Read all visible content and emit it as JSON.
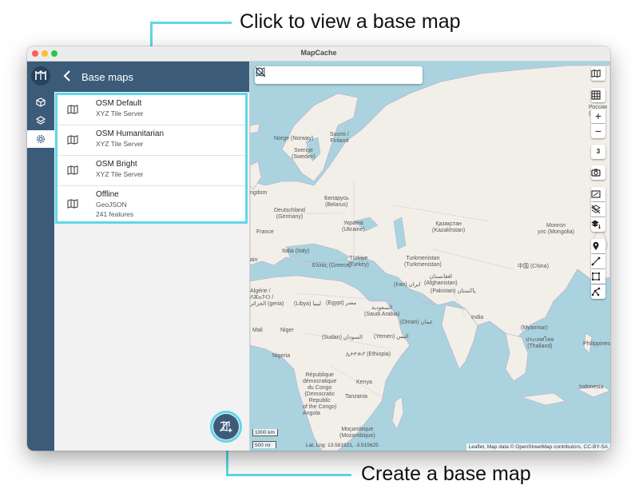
{
  "callouts": {
    "top": "Click to view a base map",
    "bottom": "Create a base map"
  },
  "window": {
    "title": "MapCache"
  },
  "panel": {
    "title": "Base maps",
    "items": [
      {
        "name": "OSM Default",
        "type": "XYZ Tile Server"
      },
      {
        "name": "OSM Humanitarian",
        "type": "XYZ Tile Server"
      },
      {
        "name": "OSM Bright",
        "type": "XYZ Tile Server"
      },
      {
        "name": "Offline",
        "type": "GeoJSON",
        "extra": "241 features"
      }
    ]
  },
  "map": {
    "zoom": "3",
    "zoom_in": "+",
    "zoom_out": "−",
    "scale_km": "1000 km",
    "scale_mi": "500 mi",
    "coords": "Lat, Lng: 13.581921, -3.515625",
    "attribution": "Leaflet, Map data © OpenStreetMap contributors, CC-BY-SA",
    "labels": {
      "norway": "Norge (Norway)",
      "sweden": "Sverige\n(Sweden)",
      "finland": "Suomi /\nFinland",
      "kingdom": "ngdom",
      "germany": "Deutschland\n(Germany)",
      "belarus": "Беларусь\n(Belarus)",
      "ukraine": "Україна\n(Ukraine)",
      "france": "France",
      "italy": "Italia (Italy)",
      "spain": "ain",
      "greece": "Ελλάς (Greece)",
      "turkey": "Türkiye\n(Turkey)",
      "kazakhstan": "Қазақстан\n(Kazakhstan)",
      "mongolia": "Монгол\nулс (Mongolia)",
      "russia": "Россия\n(Ru",
      "turkmenistan": "Turkmenistan\n(Turkmenistan)",
      "china": "中国 (China)",
      "afghanistan": "افغانستان\n(Afghanistan)",
      "iran": "(Iran) ايران",
      "pakistan": "(Pakistan) پاکستان",
      "algeria": "Algérie /\nⴷⵣⴰⵢⵔ /\nالجزائر (geria)",
      "libya": "(Libya) ليبيا",
      "egypt": "(Egypt) مصر",
      "saudi": "السعودية\n(Saudi Arabia)",
      "india": "India",
      "oman": "(Oman) عمان",
      "myanmar": "(Myanmar)",
      "mali": "Mali",
      "niger": "Niger",
      "sudan": "(Sudan) السودان",
      "yemen": "(Yemen) اليمن",
      "thailand": "ประเทศไทย\n(Thailand)",
      "philippines": "Philippines",
      "nigeria": "Nigeria",
      "ethiopia": "ኢትዮጵያ (Ethiopia)",
      "kenya": "Kenya",
      "drc": "République\ndémocratique\ndu Congo\n(Democratic\nRepublic\nof the Congo)",
      "tanzania": "Tanzania",
      "angola": "Angola",
      "mozambique": "Moçambique\n(Mozambique)",
      "indonesia": "Indonesia"
    }
  },
  "colors": {
    "accent": "#3b5b79",
    "highlight": "#5fd8e8",
    "water": "#aad3df",
    "land": "#f2efe9"
  }
}
